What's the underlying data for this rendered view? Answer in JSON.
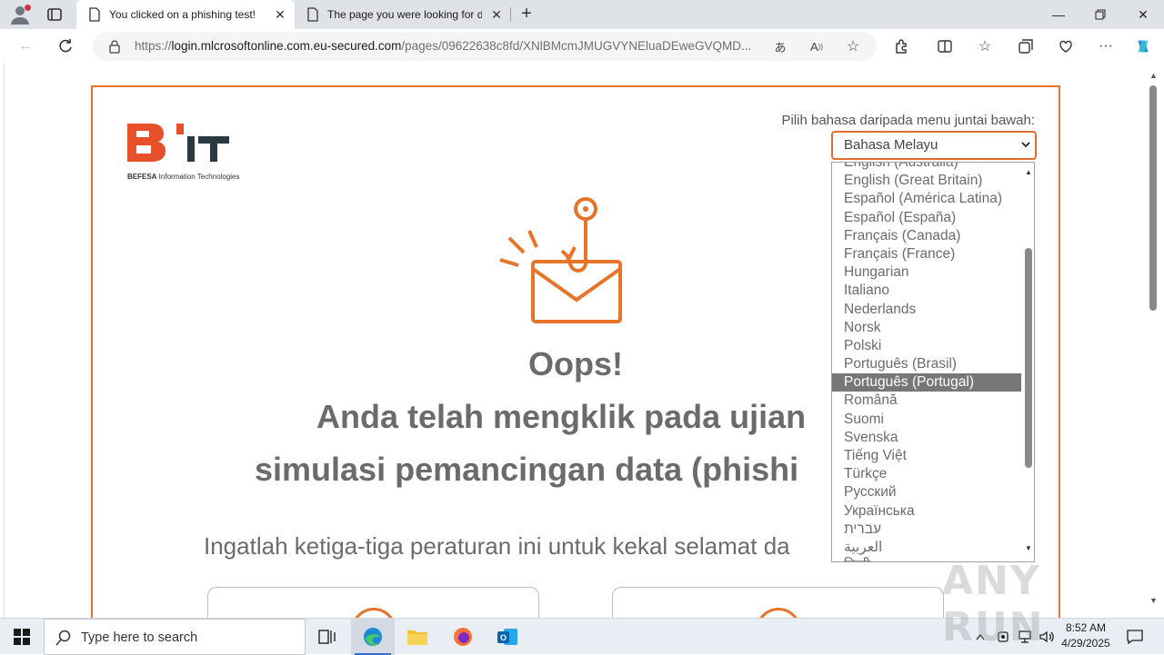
{
  "browser": {
    "tabs": [
      {
        "title": "You clicked on a phishing test!",
        "active": true
      },
      {
        "title": "The page you were looking for doesn't exist",
        "active": false
      }
    ],
    "url_scheme": "https://",
    "url_host": "login.mlcrosoftonline.com.eu-secured.com",
    "url_path": "/pages/09622638c8fd/XNlBMcmJMUGVYNEluaDEweGVQMD..."
  },
  "page": {
    "logo": {
      "letters": "B",
      "suffix": "IT",
      "sub_bold": "BEFESA",
      "sub_rest": " Information Technologies"
    },
    "language_label": "Pilih bahasa daripada menu juntai bawah:",
    "language_selected": "Bahasa Melayu",
    "oops": "Oops!",
    "headline_line1": "Anda telah mengklik pada ujian",
    "headline_line2": "simulasi pemancingan data (phishi",
    "rules_text": "Ingatlah ketiga-tiga peraturan ini untuk kekal selamat da",
    "language_options": [
      "English (Australia)",
      "English (Great Britain)",
      "Español (América Latina)",
      "Español (España)",
      "Français (Canada)",
      "Français (France)",
      "Hungarian",
      "Italiano",
      "Nederlands",
      "Norsk",
      "Polski",
      "Português (Brasil)",
      "Português (Portugal)",
      "Română",
      "Suomi",
      "Svenska",
      "Tiếng Việt",
      "Türkçe",
      "Русский",
      "Українська",
      "עברית",
      "العربية",
      "हिन्दी"
    ],
    "highlighted_option": "Português (Portugal)"
  },
  "watermark": "ANY RUN",
  "taskbar": {
    "search_placeholder": "Type here to search",
    "time": "8:52 AM",
    "date": "4/29/2025"
  },
  "colors": {
    "accent_orange": "#e8732a",
    "text_gray": "#6b6b6b",
    "logo_dark": "#2b3a42"
  }
}
